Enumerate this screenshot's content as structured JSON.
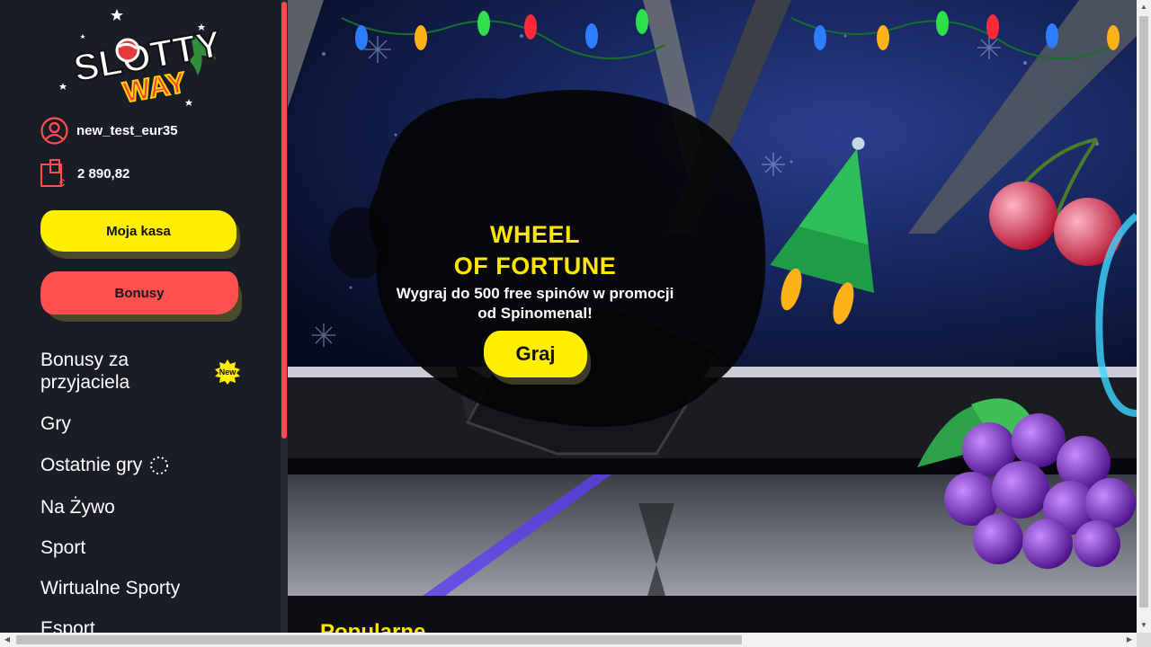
{
  "brand": {
    "logo_line1": "SLOTTY",
    "logo_line2": "WAY",
    "primary": "#ffee00",
    "accent": "#ff4f4f",
    "sidebar_bg": "#1a1c26"
  },
  "user": {
    "username": "new_test_eur35",
    "balance": "2 890,82",
    "user_icon": "user-circle-icon",
    "wallet_icon": "wallet-euro-icon"
  },
  "buttons": {
    "cashier": "Moja kasa",
    "bonuses": "Bonusy"
  },
  "nav": {
    "items": [
      {
        "label": "Bonusy za przyjaciela",
        "badge": "New"
      },
      {
        "label": "Gry"
      },
      {
        "label": "Ostatnie gry",
        "icon": "loading-spinner-icon"
      },
      {
        "label": "Na Żywo"
      },
      {
        "label": "Sport"
      },
      {
        "label": "Wirtualne Sporty"
      },
      {
        "label": "Esport"
      }
    ]
  },
  "banner": {
    "title_line1": "WHEEL",
    "title_line2": "OF FORTUNE",
    "subtitle_line1": "Wygraj do 500 free spinów w promocji",
    "subtitle_line2": "od Spinomenal!",
    "cta": "Graj"
  },
  "section": {
    "popular_title": "Popularne"
  }
}
